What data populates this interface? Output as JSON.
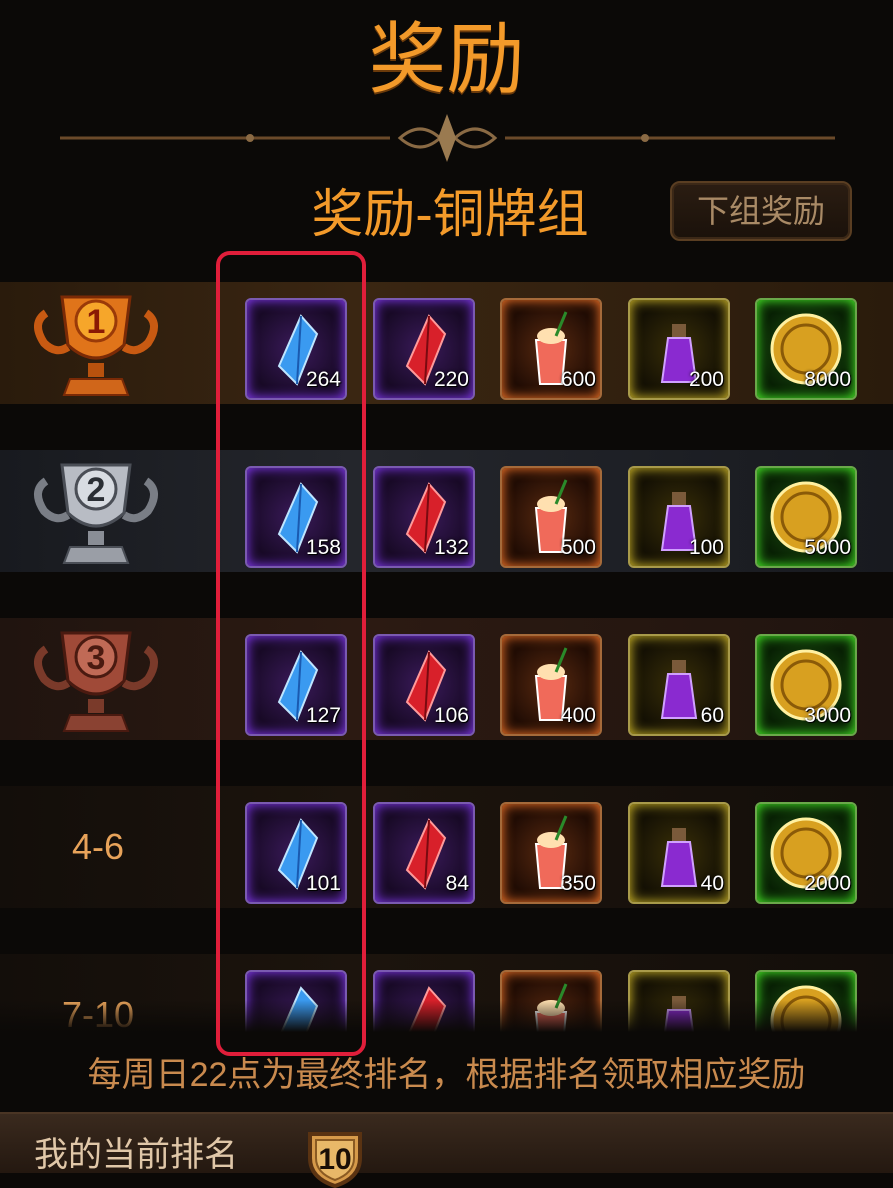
{
  "header": {
    "title": "奖励"
  },
  "group": {
    "title": "奖励-铜牌组",
    "next_button": "下组奖励"
  },
  "rows": [
    {
      "rank": "1",
      "trophy": "gold-trophy-icon",
      "items": [
        "264",
        "220",
        "600",
        "200",
        "8000"
      ]
    },
    {
      "rank": "2",
      "trophy": "silver-trophy-icon",
      "items": [
        "158",
        "132",
        "500",
        "100",
        "5000"
      ]
    },
    {
      "rank": "3",
      "trophy": "bronze-trophy-icon",
      "items": [
        "127",
        "106",
        "400",
        "60",
        "3000"
      ]
    },
    {
      "rank": "4-6",
      "items": [
        "101",
        "84",
        "350",
        "40",
        "2000"
      ]
    },
    {
      "rank": "7-10",
      "items": [
        "",
        "",
        "",
        "",
        ""
      ]
    }
  ],
  "item_types": [
    "blue-crystal-icon",
    "red-crystal-icon",
    "drink-icon",
    "purple-potion-icon",
    "gold-coin-icon"
  ],
  "footer": {
    "note": "每周日22点为最终排名，根据排名领取相应奖励",
    "my_rank_label": "我的当前排名",
    "my_rank_value": "10"
  },
  "colors": {
    "accent": "#f39a2a",
    "highlight": "#e01e3a"
  }
}
